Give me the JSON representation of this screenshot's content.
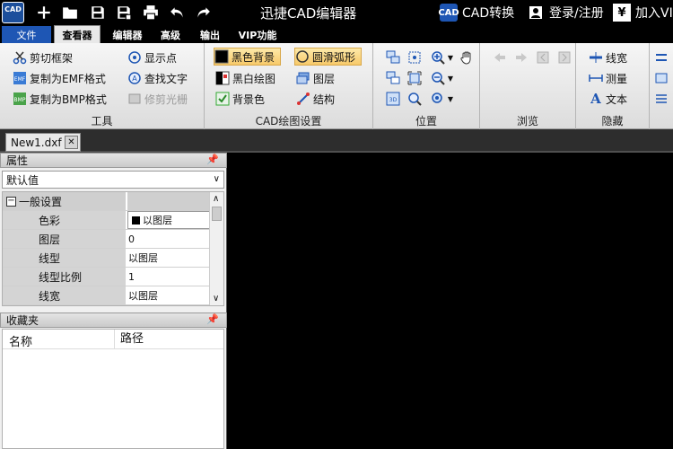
{
  "app": {
    "icon_text": "CAD",
    "title": "迅捷CAD编辑器",
    "cad_convert": "CAD转换",
    "cad_convert_icon_text": "CAD",
    "login": "登录/注册",
    "vip_join": "加入VIP",
    "yen_symbol": "¥"
  },
  "tabs": {
    "file": "文件",
    "viewer": "查看器",
    "editor": "编辑器",
    "advanced": "高级",
    "output": "输出",
    "vip": "VIP功能"
  },
  "ribbon": {
    "tools": {
      "label": "工具",
      "clip_frame": "剪切框架",
      "copy_emf": "复制为EMF格式",
      "copy_bmp": "复制为BMP格式",
      "show_points": "显示点",
      "find_text": "查找文字",
      "trim_raster": "修剪光栅"
    },
    "cad_settings": {
      "label": "CAD绘图设置",
      "black_bg": "黑色背景",
      "bw_drawing": "黑白绘图",
      "bg_color": "背景色",
      "smooth_arc": "圆滑弧形",
      "layers": "图层",
      "structure": "结构"
    },
    "position": {
      "label": "位置"
    },
    "browse": {
      "label": "浏览"
    },
    "hide": {
      "label": "隐藏",
      "line_width": "线宽",
      "measure": "测量",
      "text": "文本"
    }
  },
  "doc_tab": {
    "name": "New1.dxf"
  },
  "properties": {
    "header": "属性",
    "default_value": "默认值",
    "section": "一般设置",
    "rows": [
      {
        "name": "色彩",
        "value": "以图层"
      },
      {
        "name": "图层",
        "value": "0"
      },
      {
        "name": "线型",
        "value": "以图层"
      },
      {
        "name": "线型比例",
        "value": "1"
      },
      {
        "name": "线宽",
        "value": "以图层"
      }
    ]
  },
  "favorites": {
    "header": "收藏夹",
    "col_name": "名称",
    "col_path": "路径"
  },
  "colors": {
    "title_bg": "#000000",
    "file_tab": "#1e56b4",
    "canvas": "#000000",
    "highlight": "#f7c96a"
  }
}
